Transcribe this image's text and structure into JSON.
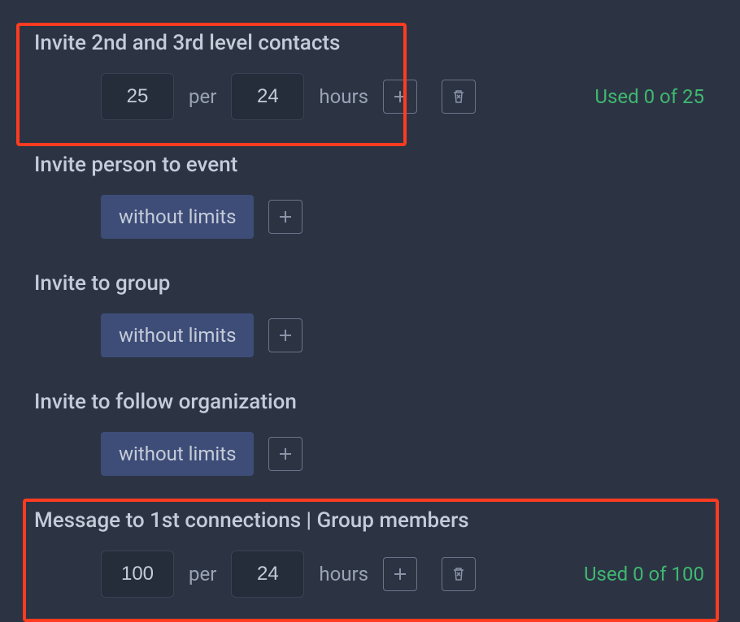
{
  "common": {
    "per": "per",
    "hours": "hours",
    "without_limits": "without limits"
  },
  "groups": [
    {
      "id": "invite-2nd-3rd",
      "title": "Invite 2nd and 3rd level contacts",
      "mode": "limited",
      "amount": "25",
      "period": "24",
      "used": "Used 0 of 25",
      "has_delete": true,
      "highlight": true
    },
    {
      "id": "invite-event",
      "title": "Invite person to event",
      "mode": "unlimited",
      "has_delete": false,
      "highlight": false
    },
    {
      "id": "invite-group",
      "title": "Invite to group",
      "mode": "unlimited",
      "has_delete": false,
      "highlight": false
    },
    {
      "id": "invite-follow-org",
      "title": "Invite to follow organization",
      "mode": "unlimited",
      "has_delete": false,
      "highlight": false
    },
    {
      "id": "message-1st-group",
      "title": "Message to 1st connections | Group members",
      "mode": "limited",
      "amount": "100",
      "period": "24",
      "used": "Used 0 of 100",
      "has_delete": true,
      "highlight": true
    }
  ]
}
